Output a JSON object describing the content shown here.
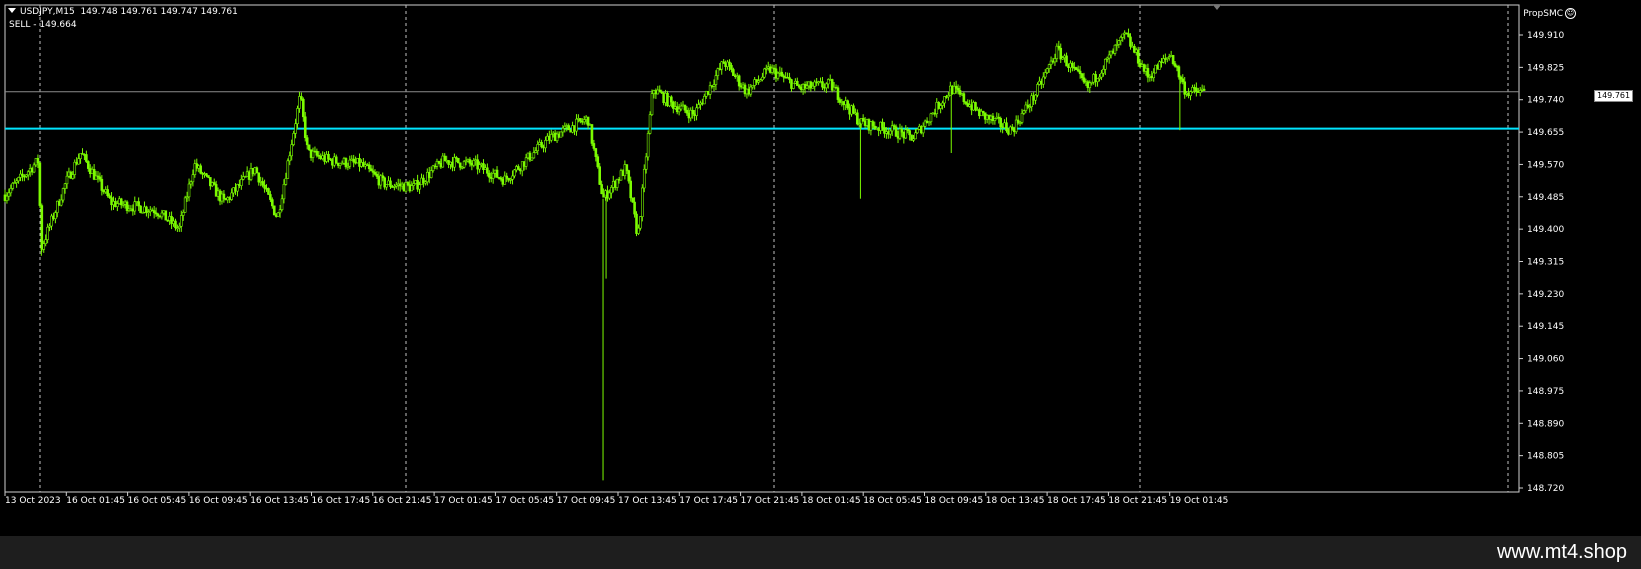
{
  "header": {
    "symbol": "USDJPY,M15",
    "ohlc": "149.748 149.761 149.747 149.761",
    "order_line": "SELL - 149.664"
  },
  "indicator": {
    "name": "PropSMC",
    "icon": "smiley-icon"
  },
  "price_axis": {
    "labels": [
      "149.910",
      "149.825",
      "149.740",
      "149.655",
      "149.570",
      "149.485",
      "149.400",
      "149.315",
      "149.230",
      "149.145",
      "149.060",
      "148.975",
      "148.890",
      "148.805",
      "148.720"
    ],
    "current_price": "149.761"
  },
  "time_axis": {
    "labels": [
      "13 Oct 2023",
      "16 Oct 01:45",
      "16 Oct 05:45",
      "16 Oct 09:45",
      "16 Oct 13:45",
      "16 Oct 17:45",
      "16 Oct 21:45",
      "17 Oct 01:45",
      "17 Oct 05:45",
      "17 Oct 09:45",
      "17 Oct 13:45",
      "17 Oct 17:45",
      "17 Oct 21:45",
      "18 Oct 01:45",
      "18 Oct 05:45",
      "18 Oct 09:45",
      "18 Oct 13:45",
      "18 Oct 17:45",
      "18 Oct 21:45",
      "19 Oct 01:45"
    ]
  },
  "colors": {
    "candle": "#7CFC00",
    "order_line": "#00E5FF",
    "grid": "#c0c0c0",
    "bid_line": "#8c8c8c"
  },
  "chart_data": {
    "type": "candlestick",
    "symbol": "USDJPY",
    "timeframe": "M15",
    "ylim": [
      148.72,
      149.95
    ],
    "sell_level": 149.664,
    "current_bid": 149.761,
    "close_path": [
      {
        "t": 0,
        "v": 149.49
      },
      {
        "t": 0.022,
        "v": 149.58
      },
      {
        "t": 0.024,
        "v": 149.35
      },
      {
        "t": 0.04,
        "v": 149.52
      },
      {
        "t": 0.05,
        "v": 149.6
      },
      {
        "t": 0.07,
        "v": 149.47
      },
      {
        "t": 0.1,
        "v": 149.45
      },
      {
        "t": 0.115,
        "v": 149.4
      },
      {
        "t": 0.125,
        "v": 149.57
      },
      {
        "t": 0.145,
        "v": 149.47
      },
      {
        "t": 0.165,
        "v": 149.56
      },
      {
        "t": 0.18,
        "v": 149.43
      },
      {
        "t": 0.195,
        "v": 149.75
      },
      {
        "t": 0.2,
        "v": 149.6
      },
      {
        "t": 0.215,
        "v": 149.58
      },
      {
        "t": 0.235,
        "v": 149.57
      },
      {
        "t": 0.25,
        "v": 149.52
      },
      {
        "t": 0.27,
        "v": 149.51
      },
      {
        "t": 0.29,
        "v": 149.58
      },
      {
        "t": 0.31,
        "v": 149.57
      },
      {
        "t": 0.33,
        "v": 149.53
      },
      {
        "t": 0.36,
        "v": 149.64
      },
      {
        "t": 0.385,
        "v": 149.69
      },
      {
        "t": 0.395,
        "v": 149.48
      },
      {
        "t": 0.41,
        "v": 149.56
      },
      {
        "t": 0.418,
        "v": 149.38
      },
      {
        "t": 0.428,
        "v": 149.77
      },
      {
        "t": 0.44,
        "v": 149.73
      },
      {
        "t": 0.455,
        "v": 149.7
      },
      {
        "t": 0.475,
        "v": 149.84
      },
      {
        "t": 0.49,
        "v": 149.76
      },
      {
        "t": 0.505,
        "v": 149.82
      },
      {
        "t": 0.525,
        "v": 149.77
      },
      {
        "t": 0.545,
        "v": 149.78
      },
      {
        "t": 0.565,
        "v": 149.68
      },
      {
        "t": 0.585,
        "v": 149.66
      },
      {
        "t": 0.6,
        "v": 149.64
      },
      {
        "t": 0.625,
        "v": 149.77
      },
      {
        "t": 0.645,
        "v": 149.7
      },
      {
        "t": 0.665,
        "v": 149.66
      },
      {
        "t": 0.68,
        "v": 149.75
      },
      {
        "t": 0.695,
        "v": 149.87
      },
      {
        "t": 0.715,
        "v": 149.77
      },
      {
        "t": 0.74,
        "v": 149.91
      },
      {
        "t": 0.755,
        "v": 149.8
      },
      {
        "t": 0.77,
        "v": 149.86
      },
      {
        "t": 0.78,
        "v": 149.76
      },
      {
        "t": 0.792,
        "v": 149.761
      }
    ],
    "spikes": [
      {
        "t": 0.024,
        "low": 149.33
      },
      {
        "t": 0.395,
        "low": 148.74
      },
      {
        "t": 0.397,
        "low": 149.27
      },
      {
        "t": 0.565,
        "low": 149.48
      },
      {
        "t": 0.625,
        "low": 149.6
      },
      {
        "t": 0.776,
        "low": 149.66
      }
    ]
  }
}
